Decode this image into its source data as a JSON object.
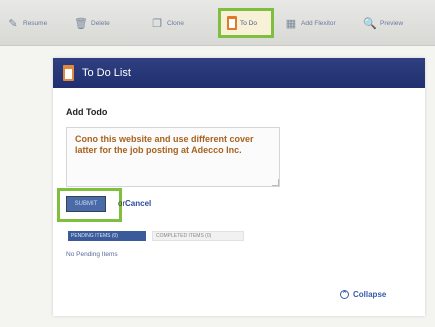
{
  "toolbar": {
    "items": [
      {
        "label": "Resume",
        "icon": "pencil-icon"
      },
      {
        "label": "Delete",
        "icon": "trash-icon"
      },
      {
        "label": "Clone",
        "icon": "clone-icon"
      },
      {
        "label": "To Do",
        "icon": "notepad-icon",
        "active": true
      },
      {
        "label": "Add Flexitor",
        "icon": "grid-icon"
      },
      {
        "label": "Preview",
        "icon": "magnifier-icon"
      }
    ],
    "highlight_color": "#7fbf3f"
  },
  "panel": {
    "title": "To Do List",
    "header_color": "#22326f"
  },
  "form": {
    "add_label": "Add Todo",
    "todo_text": "Cono this website and use different cover latter for the job posting at Adecco Inc.",
    "submit_label": "SUBMIT",
    "or_text": "or",
    "cancel_label": "Cancel"
  },
  "tabs": {
    "pending": "PENDING ITEMS (0)",
    "completed": "COMPLETED ITEMS (0)"
  },
  "status": {
    "no_pending": "No Pending Items"
  },
  "footer": {
    "collapse_label": "Collapse"
  }
}
